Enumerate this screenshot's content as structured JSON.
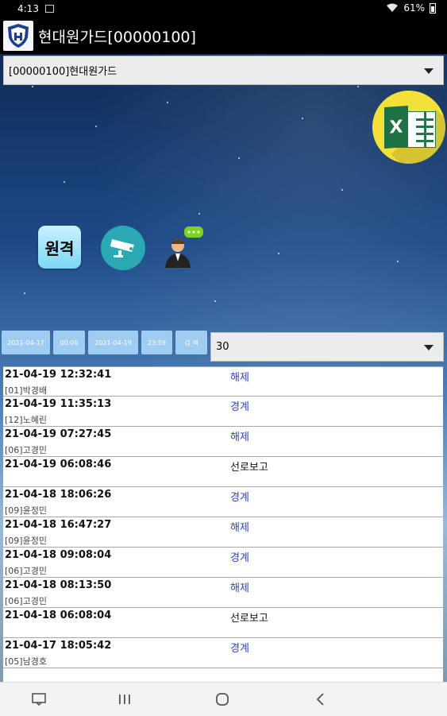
{
  "status_bar": {
    "time": "4:13",
    "battery": "61%",
    "image_icon": "image-icon",
    "wifi_icon": "wifi-icon",
    "battery_icon": "battery-icon"
  },
  "app_bar": {
    "title": "현대원가드[00000100]",
    "logo_icon": "shield-logo-icon"
  },
  "site_select": {
    "value": "[00000100]현대원가드"
  },
  "actions": {
    "excel_icon": "excel-icon",
    "remote_label": "원격",
    "cctv_icon": "cctv-camera-icon",
    "guard_icon": "guard-chat-icon"
  },
  "filter": {
    "start_date": "2021-04-17",
    "start_time": "00:00",
    "end_date": "2021-04-19",
    "end_time": "23:59",
    "search_label": "검 색",
    "limit_value": "30"
  },
  "colors": {
    "accent_blue": "#2d42c8",
    "chip_bg": "#9fcdf2",
    "excel_yellow": "#f3e13a"
  },
  "events": [
    {
      "time": "21-04-19 12:32:41",
      "user": "[01]박경배",
      "event": "해제",
      "type": "disarm"
    },
    {
      "time": "21-04-19 11:35:13",
      "user": "[12]노혜린",
      "event": "경계",
      "type": "arm"
    },
    {
      "time": "21-04-19 07:27:45",
      "user": "[06]고경민",
      "event": "해제",
      "type": "disarm"
    },
    {
      "time": "21-04-19 06:08:46",
      "user": "",
      "event": "선로보고",
      "type": "line"
    },
    {
      "time": "21-04-18 18:06:26",
      "user": "[09]윤정민",
      "event": "경계",
      "type": "arm"
    },
    {
      "time": "21-04-18 16:47:27",
      "user": "[09]윤정민",
      "event": "해제",
      "type": "disarm"
    },
    {
      "time": "21-04-18 09:08:04",
      "user": "[06]고경민",
      "event": "경계",
      "type": "arm"
    },
    {
      "time": "21-04-18 08:13:50",
      "user": "[06]고경민",
      "event": "해제",
      "type": "disarm"
    },
    {
      "time": "21-04-18 06:08:04",
      "user": "",
      "event": "선로보고",
      "type": "line"
    },
    {
      "time": "21-04-17 18:05:42",
      "user": "[05]남경호",
      "event": "경계",
      "type": "arm"
    }
  ],
  "nav_bar": {
    "keyboard_icon": "keyboard-icon",
    "recents_icon": "recents-icon",
    "home_icon": "home-icon",
    "back_icon": "back-icon"
  }
}
